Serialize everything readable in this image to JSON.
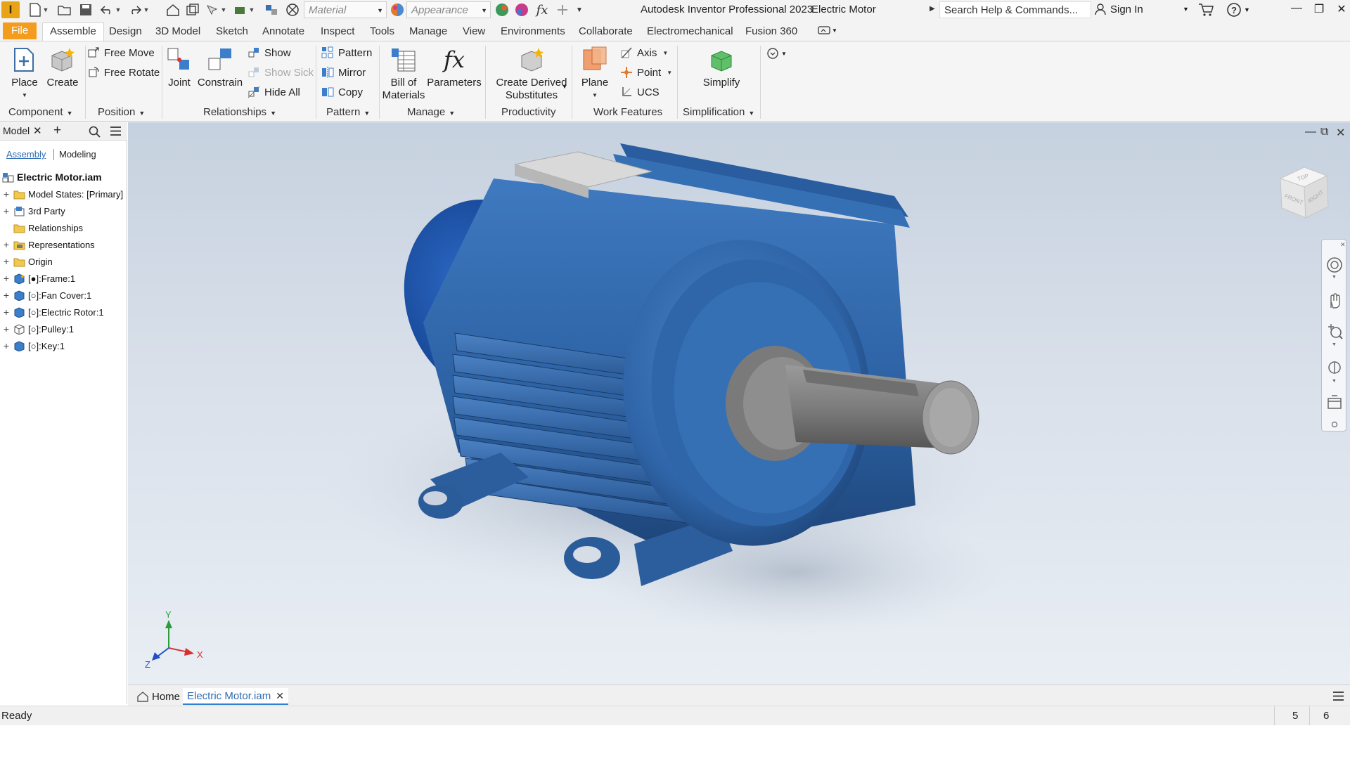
{
  "app": {
    "title": "Autodesk Inventor Professional 2023",
    "document": "Electric Motor",
    "logo_letter": "I"
  },
  "qat": {
    "material_placeholder": "Material",
    "appearance_placeholder": "Appearance",
    "fx_label": "fx"
  },
  "search": {
    "placeholder": "Search Help & Commands..."
  },
  "account": {
    "sign_in": "Sign In"
  },
  "ribbon_tabs": [
    "File",
    "Assemble",
    "Design",
    "3D Model",
    "Sketch",
    "Annotate",
    "Inspect",
    "Tools",
    "Manage",
    "View",
    "Environments",
    "Collaborate",
    "Electromechanical",
    "Fusion 360"
  ],
  "ribbon": {
    "component": {
      "place": "Place",
      "create": "Create",
      "label": "Component"
    },
    "position": {
      "free_move": "Free Move",
      "free_rotate": "Free Rotate",
      "label": "Position"
    },
    "relationships": {
      "joint": "Joint",
      "constrain": "Constrain",
      "show": "Show",
      "show_sick": "Show Sick",
      "hide_all": "Hide All",
      "label": "Relationships"
    },
    "pattern": {
      "pattern": "Pattern",
      "mirror": "Mirror",
      "copy": "Copy",
      "label": "Pattern"
    },
    "manage": {
      "bom_line1": "Bill of",
      "bom_line2": "Materials",
      "parameters": "Parameters",
      "fx": "fx",
      "label": "Manage"
    },
    "productivity": {
      "line1": "Create Derived",
      "line2": "Substitutes",
      "label": "Productivity"
    },
    "work_features": {
      "plane": "Plane",
      "axis": "Axis",
      "point": "Point",
      "ucs": "UCS",
      "label": "Work Features"
    },
    "simplification": {
      "simplify": "Simplify",
      "label": "Simplification"
    }
  },
  "browser": {
    "title": "Model",
    "subtabs": {
      "assembly": "Assembly",
      "modeling": "Modeling"
    },
    "root": "Electric Motor.iam",
    "items": [
      {
        "label": "Model States: [Primary]",
        "icon": "folder-icon",
        "expand": true
      },
      {
        "label": "3rd Party",
        "icon": "third-party-icon",
        "expand": true
      },
      {
        "label": "Relationships",
        "icon": "folder-icon",
        "expand": false
      },
      {
        "label": "Representations",
        "icon": "representations-icon",
        "expand": true
      },
      {
        "label": "Origin",
        "icon": "folder-icon",
        "expand": true
      },
      {
        "label": "[●]:Frame:1",
        "icon": "part-icon",
        "expand": true
      },
      {
        "label": "[○]:Fan Cover:1",
        "icon": "part-icon",
        "expand": true
      },
      {
        "label": "[○]:Electric Rotor:1",
        "icon": "part-icon",
        "expand": true
      },
      {
        "label": "[○]:Pulley:1",
        "icon": "part-outline-icon",
        "expand": true
      },
      {
        "label": "[○]:Key:1",
        "icon": "part-icon",
        "expand": true
      }
    ]
  },
  "viewcube": {
    "top": "TOP",
    "front": "FRONT",
    "right": "RIGHT"
  },
  "triad": {
    "x": "X",
    "y": "Y",
    "z": "Z"
  },
  "doc_tabs": {
    "home": "Home",
    "active": "Electric Motor.iam"
  },
  "status": {
    "text": "Ready",
    "count1": "5",
    "count2": "6"
  },
  "colors": {
    "accent_file": "#f39c1e",
    "motor_blue": "#2f63a6",
    "tab_active_underline": "#2f7fd3"
  }
}
